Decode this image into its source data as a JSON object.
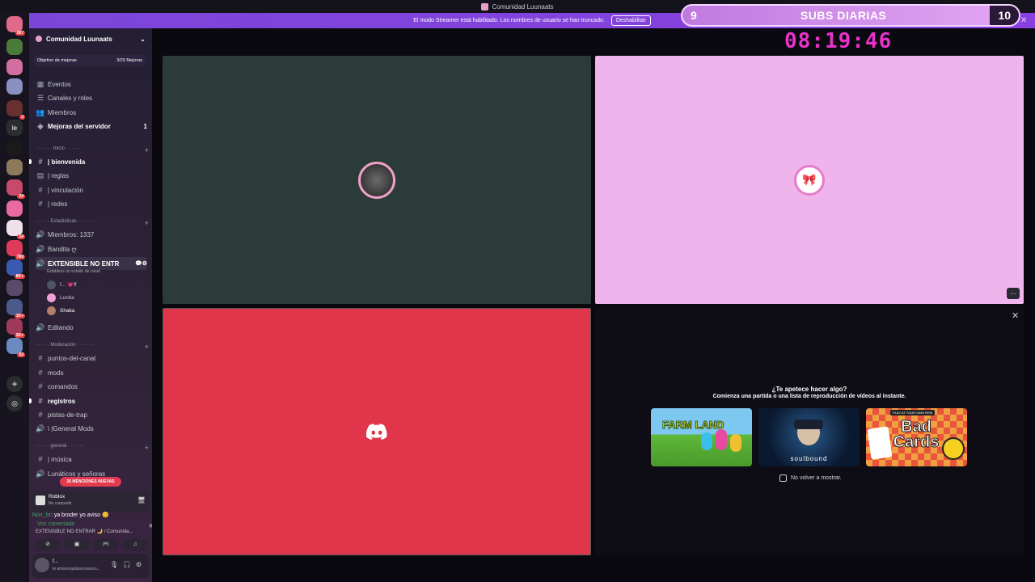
{
  "window": {
    "title": "Comunidad Luunaats"
  },
  "streamer_bar": {
    "message": "El modo Streamer está habilitado. Los nombres de usuario se han truncado.",
    "button": "Deshabilitar"
  },
  "subs_widget": {
    "current": "9",
    "label": "SUBS DIARIAS",
    "goal": "10"
  },
  "timer": "08:19:46",
  "server_rail": [
    {
      "badge": "267",
      "color": "#e06a8a"
    },
    {
      "badge": "",
      "color": "#4a7a3a"
    },
    {
      "badge": "",
      "color": "#d36fa0"
    },
    {
      "badge": "",
      "color": "#8a90c0"
    },
    {
      "badge": "3",
      "color": "#6a3030"
    },
    {
      "badge": "",
      "label": "le",
      "color": "#2b2d31"
    },
    {
      "badge": "",
      "color": "#1a1a1a"
    },
    {
      "badge": "",
      "color": "#8c7a5a"
    },
    {
      "badge": "24",
      "color": "#c84a6a"
    },
    {
      "badge": "",
      "color": "#e86aa0"
    },
    {
      "badge": "14",
      "color": "#f0e0ea"
    },
    {
      "badge": "789",
      "color": "#e03a5a"
    },
    {
      "badge": "8K+",
      "color": "#3a5ab0"
    },
    {
      "badge": "",
      "color": "#5a4a6a"
    },
    {
      "badge": "1K+",
      "color": "#4a5a8a"
    },
    {
      "badge": "2K+",
      "color": "#a03a5a"
    },
    {
      "badge": "53",
      "color": "#6a8ac0"
    }
  ],
  "sidebar": {
    "server_name": "Comunidad Luunaats",
    "boost_goal": {
      "label": "Objetivo de mejoras",
      "progress": "3/20 Mejoras"
    },
    "top_items": [
      {
        "icon": "calendar-icon",
        "label": "Eventos"
      },
      {
        "icon": "browse-icon",
        "label": "Canales y roles"
      },
      {
        "icon": "members-icon",
        "label": "Miembros"
      },
      {
        "icon": "boost-icon",
        "label": "Mejoras del servidor",
        "badge": "1"
      }
    ],
    "categories": {
      "inicio": "· · · · · · Inicio · · · · · ·",
      "estadisticas": "· · · · · Estadísticas · · · · · ·",
      "moderacion": "· · · · · Moderación · · · · · ·",
      "general": "· · · · · general · · · · · ·"
    },
    "inicio_channels": [
      "| bienvenida",
      "| reglas",
      "| vinculación",
      "| redes"
    ],
    "stats_channels": [
      "Miembros: 1337",
      "Bandita ღ",
      "EXTENSIBLE NO ENTRAR 🌙"
    ],
    "voice_status": "Establece un estado de canal",
    "voice_users": [
      "f... 💗ff",
      "Lunita",
      "Shaka"
    ],
    "editando": "Editando",
    "mod_channels": [
      "puntos-del-canal",
      "mods",
      "comandos",
      "registros",
      "pistas-de-trap",
      "\\ |General Mods"
    ],
    "general_channels": [
      "| música",
      "Lunáticos y señoras"
    ],
    "mentions_pill": "26 MENCIONES NUEVAS"
  },
  "activity": {
    "game": "Roblox",
    "status": "No compartir"
  },
  "chat_preview": {
    "user": "Noir_br",
    "message": ": ya broder yo aviso 😊"
  },
  "voice": {
    "status": "Voz conectada",
    "channel": "EXTENSIBLE NO ENTRAR 🌙 / Comunida..."
  },
  "user_panel": {
    "name": "f...",
    "status": "te amoooojuliooooooooo..."
  },
  "activity_picker": {
    "title": "¿Te apetece hacer algo?",
    "subtitle": "Comienza una partida o una lista de reproducción de vídeos al instante.",
    "games": [
      "FARM LAND",
      "soulbound",
      "Bad Cards"
    ],
    "bad_cards_banner": "PLAY AT YOUR OWN RISK",
    "dont_show": "No volver a mostrar."
  },
  "colors": {
    "accent": "#5865f2",
    "timer": "#e832c8",
    "tile_red": "#e0354a",
    "tile_pink": "#f0b4ec",
    "tile_green": "#2b3c38"
  }
}
